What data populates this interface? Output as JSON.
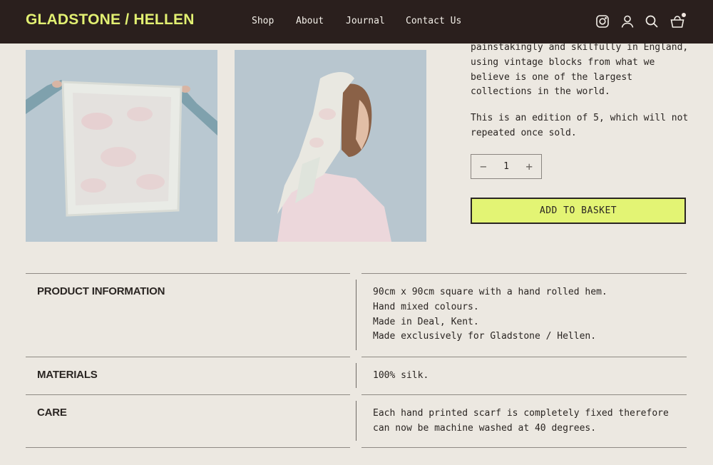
{
  "brand": {
    "logo": "GLADSTONE / HELLEN",
    "accent": "#e3f474",
    "header_bg": "#2a1f1d"
  },
  "nav": {
    "items": [
      "Shop",
      "About",
      "Journal",
      "Contact Us"
    ]
  },
  "header_icons": [
    "instagram-icon",
    "account-icon",
    "search-icon",
    "basket-icon"
  ],
  "gallery": {
    "images": [
      "scarf-held-open",
      "model-wearing-scarf"
    ]
  },
  "product": {
    "description_1": "painstakingly and skilfully in England, using vintage blocks from what we believe is one of the largest collections in the world.",
    "description_2": "This is an edition of 5, which will not repeated once sold.",
    "quantity": "1",
    "quantity_minus": "−",
    "quantity_plus": "+",
    "add_to_basket": "ADD TO BASKET"
  },
  "info": {
    "rows": [
      {
        "label": "PRODUCT INFORMATION",
        "lines": [
          "90cm x 90cm square with a hand rolled hem.",
          "Hand mixed colours.",
          "Made in Deal, Kent.",
          "Made exclusively for Gladstone / Hellen."
        ]
      },
      {
        "label": "MATERIALS",
        "lines": [
          "100% silk."
        ]
      },
      {
        "label": "CARE",
        "lines": [
          "Each hand printed scarf is completely fixed therefore",
          "can now be machine washed at 40 degrees."
        ]
      }
    ]
  }
}
